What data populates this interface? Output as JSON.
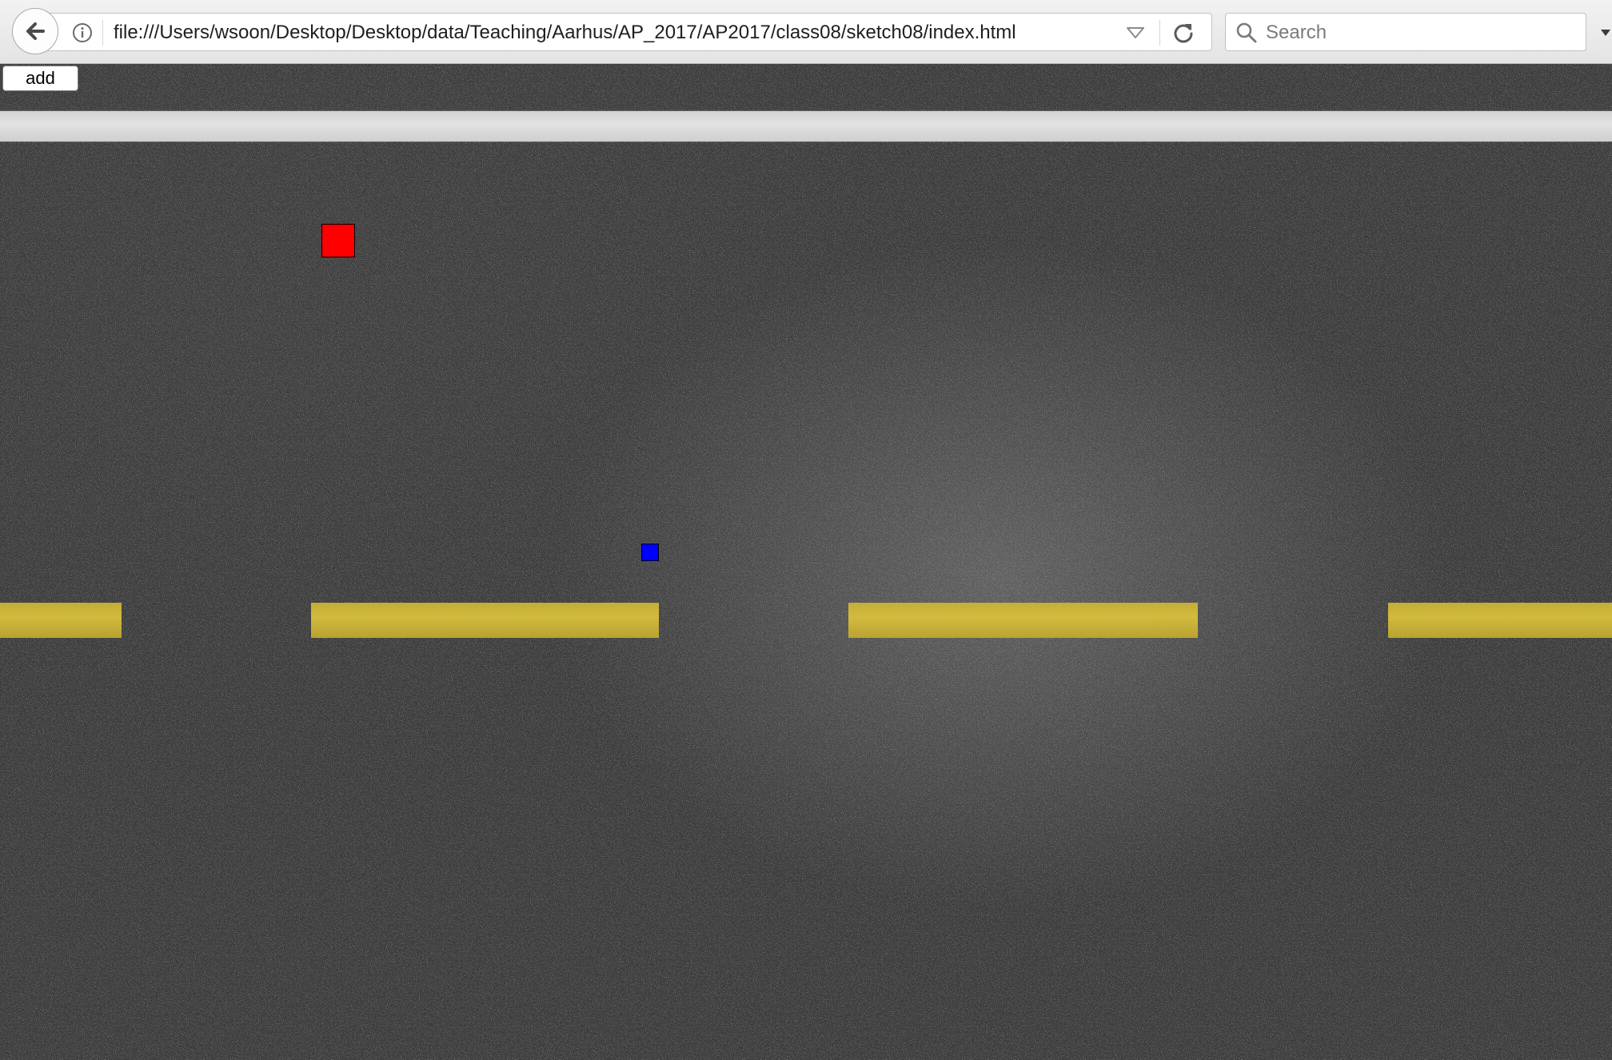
{
  "browser": {
    "url": "file:///Users/wsoon/Desktop/Desktop/data/Teaching/Aarhus/AP_2017/AP2017/class08/sketch08/index.html",
    "search_placeholder": "Search",
    "icons": {
      "back": "back-arrow-icon",
      "info": "info-icon",
      "dropdown": "chevron-down-icon",
      "reload": "reload-icon",
      "search": "search-icon",
      "overflow": "overflow-menu-icon"
    }
  },
  "sketch": {
    "add_button_label": "add",
    "colors": {
      "road": "#3d3d3d",
      "edge_line": "#dcdcdc",
      "center_line": "#d4bb3a",
      "red_square": "#ff0000",
      "blue_square": "#0000ff"
    }
  }
}
